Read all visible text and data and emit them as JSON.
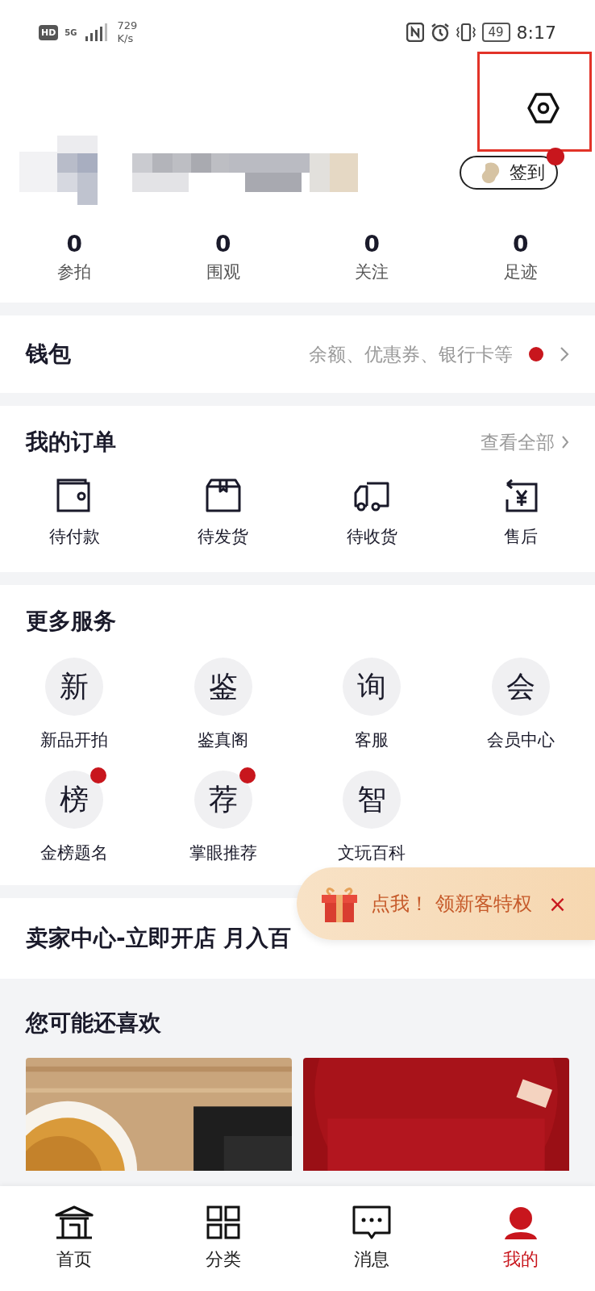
{
  "status_bar": {
    "network_badge": "HD",
    "network_type": "5G",
    "speed_value": "729",
    "speed_unit": "K/s",
    "battery": "49",
    "time": "8:17"
  },
  "header": {
    "checkin_label": "签到",
    "checkin_badge": true,
    "settings_highlighted": true
  },
  "stats": [
    {
      "value": "0",
      "label": "参拍"
    },
    {
      "value": "0",
      "label": "围观"
    },
    {
      "value": "0",
      "label": "关注"
    },
    {
      "value": "0",
      "label": "足迹"
    }
  ],
  "wallet": {
    "title": "钱包",
    "hint": "余额、优惠券、银行卡等",
    "badge": true
  },
  "orders": {
    "title": "我的订单",
    "link": "查看全部",
    "items": [
      {
        "kind": "wallet",
        "label": "待付款"
      },
      {
        "kind": "box",
        "label": "待发货"
      },
      {
        "kind": "truck",
        "label": "待收货"
      },
      {
        "kind": "refund",
        "label": "售后"
      }
    ]
  },
  "services": {
    "title": "更多服务",
    "items": [
      {
        "glyph": "新",
        "label": "新品开拍",
        "badge": false
      },
      {
        "glyph": "鉴",
        "label": "鉴真阁",
        "badge": false
      },
      {
        "glyph": "询",
        "label": "客服",
        "badge": false
      },
      {
        "glyph": "会",
        "label": "会员中心",
        "badge": false
      },
      {
        "glyph": "榜",
        "label": "金榜题名",
        "badge": true
      },
      {
        "glyph": "荐",
        "label": "掌眼推荐",
        "badge": true
      },
      {
        "glyph": "智",
        "label": "文玩百科",
        "badge": false
      }
    ]
  },
  "seller": {
    "title": "卖家中心-立即开店 月入百"
  },
  "promo": {
    "text": "点我！ 领新客特权",
    "close": "×"
  },
  "recommend": {
    "title": "您可能还喜欢"
  },
  "tab_bar": [
    {
      "kind": "home",
      "label": "首页",
      "selected": false
    },
    {
      "kind": "grid",
      "label": "分类",
      "selected": false
    },
    {
      "kind": "message",
      "label": "消息",
      "selected": false
    },
    {
      "kind": "profile",
      "label": "我的",
      "selected": true
    }
  ]
}
